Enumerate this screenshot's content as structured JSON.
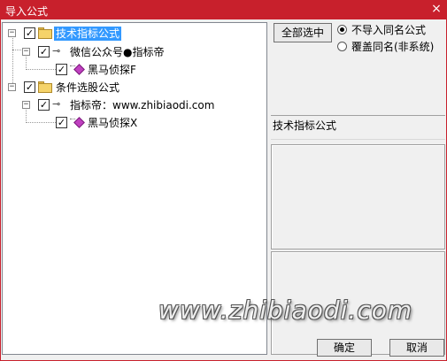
{
  "window": {
    "title": "导入公式",
    "close_glyph": "×"
  },
  "tree": {
    "expander_minus": "−",
    "check_glyph": "✓",
    "key_glyph": "⊸",
    "nodes": [
      {
        "label": "技术指标公式",
        "checked": true,
        "selected": true
      },
      {
        "label": "微信公众号●指标帝",
        "checked": true
      },
      {
        "label": "黑马侦探F",
        "checked": true
      },
      {
        "label": "条件选股公式",
        "checked": true
      },
      {
        "label": "指标帝：www.zhibiaodi.com",
        "checked": true
      },
      {
        "label": "黑马侦探X",
        "checked": true
      }
    ]
  },
  "options": {
    "select_all_label": "全部选中",
    "radio_skip_label": "不导入同名公式",
    "radio_overwrite_label": "覆盖同名(非系统)",
    "selected": "skip"
  },
  "info": {
    "category_text": "技术指标公式"
  },
  "buttons": {
    "ok_label": "确定",
    "cancel_label": "取消"
  },
  "watermark": {
    "text": "www.zhibiaodi.com"
  },
  "colors": {
    "titlebar": "#c8202c",
    "selection": "#3399ff",
    "folder": "#f5d36a",
    "formula_gem": "#c040c0"
  }
}
